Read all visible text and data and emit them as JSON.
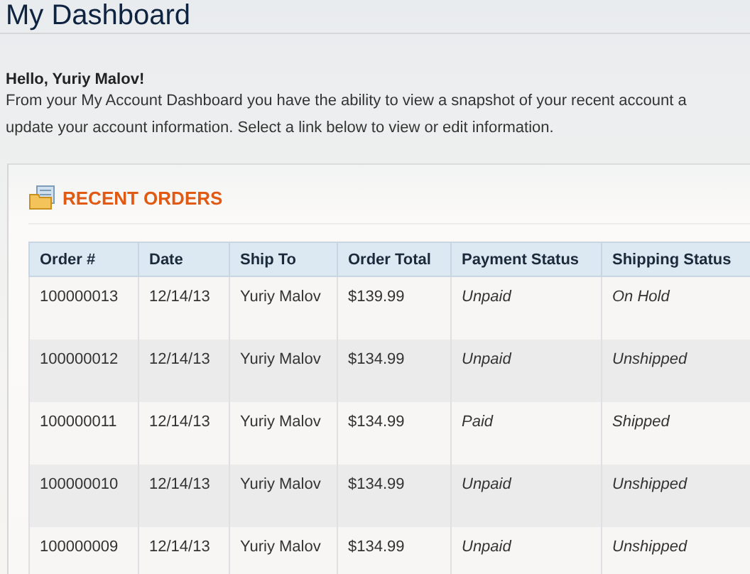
{
  "page_title": "My Dashboard",
  "greeting": "Hello, Yuriy Malov!",
  "intro_lines": [
    "From your My Account Dashboard you have the ability to view a snapshot of your recent account a",
    "update your account information. Select a link below to view or edit information."
  ],
  "recent_orders": {
    "title": "RECENT ORDERS",
    "columns": [
      "Order #",
      "Date",
      "Ship To",
      "Order Total",
      "Payment Status",
      "Shipping Status"
    ],
    "rows": [
      {
        "order": "100000013",
        "date": "12/14/13",
        "ship_to": "Yuriy Malov",
        "total": "$139.99",
        "payment": "Unpaid",
        "shipping": "On Hold"
      },
      {
        "order": "100000012",
        "date": "12/14/13",
        "ship_to": "Yuriy Malov",
        "total": "$134.99",
        "payment": "Unpaid",
        "shipping": "Unshipped"
      },
      {
        "order": "100000011",
        "date": "12/14/13",
        "ship_to": "Yuriy Malov",
        "total": "$134.99",
        "payment": "Paid",
        "shipping": "Shipped"
      },
      {
        "order": "100000010",
        "date": "12/14/13",
        "ship_to": "Yuriy Malov",
        "total": "$134.99",
        "payment": "Unpaid",
        "shipping": "Unshipped"
      },
      {
        "order": "100000009",
        "date": "12/14/13",
        "ship_to": "Yuriy Malov",
        "total": "$134.99",
        "payment": "Unpaid",
        "shipping": "Unshipped"
      }
    ]
  }
}
